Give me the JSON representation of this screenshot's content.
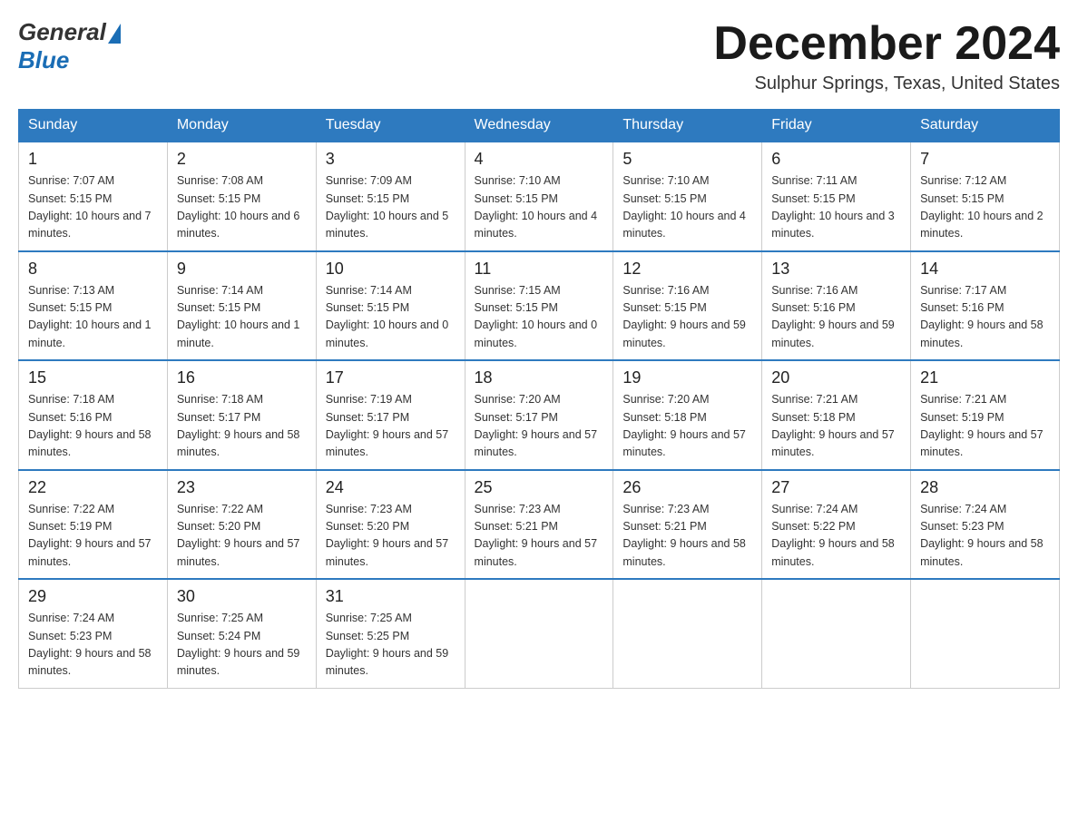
{
  "header": {
    "logo_general": "General",
    "logo_blue": "Blue",
    "title": "December 2024",
    "location": "Sulphur Springs, Texas, United States"
  },
  "weekdays": [
    "Sunday",
    "Monday",
    "Tuesday",
    "Wednesday",
    "Thursday",
    "Friday",
    "Saturday"
  ],
  "weeks": [
    [
      {
        "day": "1",
        "sunrise": "7:07 AM",
        "sunset": "5:15 PM",
        "daylight": "10 hours and 7 minutes."
      },
      {
        "day": "2",
        "sunrise": "7:08 AM",
        "sunset": "5:15 PM",
        "daylight": "10 hours and 6 minutes."
      },
      {
        "day": "3",
        "sunrise": "7:09 AM",
        "sunset": "5:15 PM",
        "daylight": "10 hours and 5 minutes."
      },
      {
        "day": "4",
        "sunrise": "7:10 AM",
        "sunset": "5:15 PM",
        "daylight": "10 hours and 4 minutes."
      },
      {
        "day": "5",
        "sunrise": "7:10 AM",
        "sunset": "5:15 PM",
        "daylight": "10 hours and 4 minutes."
      },
      {
        "day": "6",
        "sunrise": "7:11 AM",
        "sunset": "5:15 PM",
        "daylight": "10 hours and 3 minutes."
      },
      {
        "day": "7",
        "sunrise": "7:12 AM",
        "sunset": "5:15 PM",
        "daylight": "10 hours and 2 minutes."
      }
    ],
    [
      {
        "day": "8",
        "sunrise": "7:13 AM",
        "sunset": "5:15 PM",
        "daylight": "10 hours and 1 minute."
      },
      {
        "day": "9",
        "sunrise": "7:14 AM",
        "sunset": "5:15 PM",
        "daylight": "10 hours and 1 minute."
      },
      {
        "day": "10",
        "sunrise": "7:14 AM",
        "sunset": "5:15 PM",
        "daylight": "10 hours and 0 minutes."
      },
      {
        "day": "11",
        "sunrise": "7:15 AM",
        "sunset": "5:15 PM",
        "daylight": "10 hours and 0 minutes."
      },
      {
        "day": "12",
        "sunrise": "7:16 AM",
        "sunset": "5:15 PM",
        "daylight": "9 hours and 59 minutes."
      },
      {
        "day": "13",
        "sunrise": "7:16 AM",
        "sunset": "5:16 PM",
        "daylight": "9 hours and 59 minutes."
      },
      {
        "day": "14",
        "sunrise": "7:17 AM",
        "sunset": "5:16 PM",
        "daylight": "9 hours and 58 minutes."
      }
    ],
    [
      {
        "day": "15",
        "sunrise": "7:18 AM",
        "sunset": "5:16 PM",
        "daylight": "9 hours and 58 minutes."
      },
      {
        "day": "16",
        "sunrise": "7:18 AM",
        "sunset": "5:17 PM",
        "daylight": "9 hours and 58 minutes."
      },
      {
        "day": "17",
        "sunrise": "7:19 AM",
        "sunset": "5:17 PM",
        "daylight": "9 hours and 57 minutes."
      },
      {
        "day": "18",
        "sunrise": "7:20 AM",
        "sunset": "5:17 PM",
        "daylight": "9 hours and 57 minutes."
      },
      {
        "day": "19",
        "sunrise": "7:20 AM",
        "sunset": "5:18 PM",
        "daylight": "9 hours and 57 minutes."
      },
      {
        "day": "20",
        "sunrise": "7:21 AM",
        "sunset": "5:18 PM",
        "daylight": "9 hours and 57 minutes."
      },
      {
        "day": "21",
        "sunrise": "7:21 AM",
        "sunset": "5:19 PM",
        "daylight": "9 hours and 57 minutes."
      }
    ],
    [
      {
        "day": "22",
        "sunrise": "7:22 AM",
        "sunset": "5:19 PM",
        "daylight": "9 hours and 57 minutes."
      },
      {
        "day": "23",
        "sunrise": "7:22 AM",
        "sunset": "5:20 PM",
        "daylight": "9 hours and 57 minutes."
      },
      {
        "day": "24",
        "sunrise": "7:23 AM",
        "sunset": "5:20 PM",
        "daylight": "9 hours and 57 minutes."
      },
      {
        "day": "25",
        "sunrise": "7:23 AM",
        "sunset": "5:21 PM",
        "daylight": "9 hours and 57 minutes."
      },
      {
        "day": "26",
        "sunrise": "7:23 AM",
        "sunset": "5:21 PM",
        "daylight": "9 hours and 58 minutes."
      },
      {
        "day": "27",
        "sunrise": "7:24 AM",
        "sunset": "5:22 PM",
        "daylight": "9 hours and 58 minutes."
      },
      {
        "day": "28",
        "sunrise": "7:24 AM",
        "sunset": "5:23 PM",
        "daylight": "9 hours and 58 minutes."
      }
    ],
    [
      {
        "day": "29",
        "sunrise": "7:24 AM",
        "sunset": "5:23 PM",
        "daylight": "9 hours and 58 minutes."
      },
      {
        "day": "30",
        "sunrise": "7:25 AM",
        "sunset": "5:24 PM",
        "daylight": "9 hours and 59 minutes."
      },
      {
        "day": "31",
        "sunrise": "7:25 AM",
        "sunset": "5:25 PM",
        "daylight": "9 hours and 59 minutes."
      },
      null,
      null,
      null,
      null
    ]
  ],
  "labels": {
    "sunrise": "Sunrise:",
    "sunset": "Sunset:",
    "daylight": "Daylight:"
  }
}
